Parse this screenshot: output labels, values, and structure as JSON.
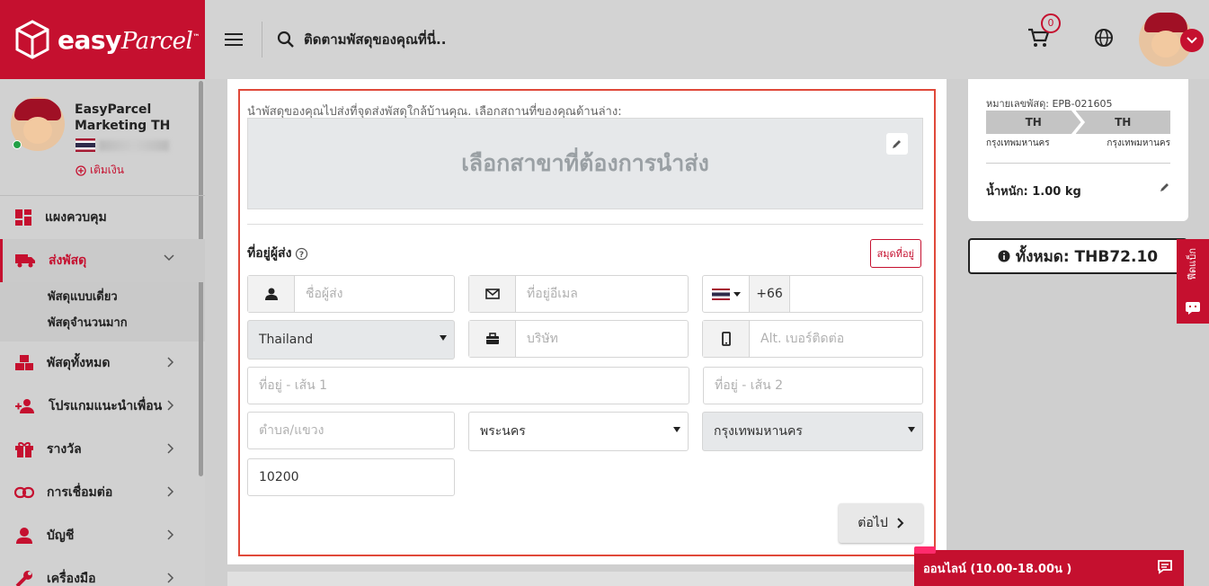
{
  "brand": {
    "name_easy": "easy",
    "name_parcel": "Parcel",
    "tm": "™"
  },
  "topbar": {
    "search_placeholder": "ติดตามพัสดุของคุณที่นี่..",
    "cart_count": "0"
  },
  "user": {
    "name_line1": "EasyParcel",
    "name_line2": "Marketing TH",
    "topup_label": "เติมเงิน"
  },
  "nav": {
    "dashboard": "แผงควบคุม",
    "send": "ส่งพัสดุ",
    "send_single": "พัสดุแบบเดี่ยว",
    "send_bulk": "พัสดุจำนวนมาก",
    "all_parcels": "พัสดุทั้งหมด",
    "referral": "โปรแกมแนะนำเพื่อน",
    "rewards": "รางวัล",
    "integration": "การเชื่อมต่อ",
    "account": "บัญชี",
    "tools": "เครื่องมือ"
  },
  "form": {
    "intro": "นำพัสดุของคุณไปส่งที่จุดส่งพัสดุใกล้บ้านคุณ. เลือกสถานที่ของคุณด้านล่าง:",
    "dropoff_label": "เลือกสาขาที่ต้องการนำส่ง",
    "section_title": "ที่อยู่ผู้ส่ง",
    "address_book": "สมุดที่อยู่",
    "sender_name_ph": "ชื่อผู้ส่ง",
    "email_ph": "ที่อยู่อีเมล",
    "phone_code": "+66",
    "country": "Thailand",
    "company_ph": "บริษัท",
    "alt_phone_ph": "Alt. เบอร์ติดต่อ",
    "address1_ph": "ที่อยู่ - เส้น 1",
    "address2_ph": "ที่อยู่ - เส้น 2",
    "subdistrict_ph": "ตำบล/แขวง",
    "district": "พระนคร",
    "province": "กรุงเทพมหานคร",
    "postcode": "10200",
    "next_label": "ต่อไป"
  },
  "summary": {
    "tracking": "หมายเลขพัสดุ: EPB-021605",
    "from_code": "TH",
    "to_code": "TH",
    "from_city": "กรุงเทพมหานคร",
    "to_city": "กรุงเทพมหานคร",
    "weight": "น้ำหนัก:  1.00 kg",
    "total": "ทั้งหมด: THB72.10"
  },
  "feedback": "ฟีดแบ็ก",
  "chat": "ออนไลน์ (10.00-18.00น )",
  "colors": {
    "brand": "#c5102f",
    "border_highlight": "#e0493a"
  }
}
